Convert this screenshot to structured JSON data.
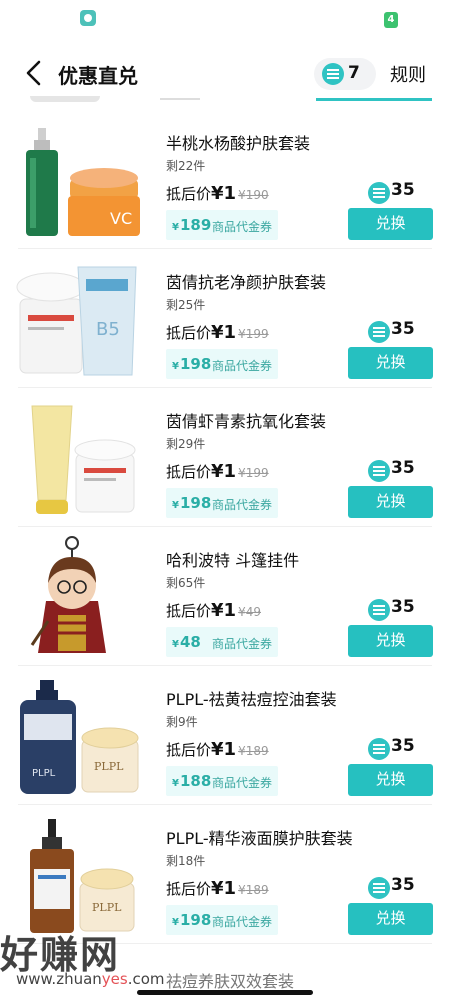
{
  "status_bar": {
    "right_badge": "4"
  },
  "header": {
    "title": "优惠直兑",
    "points": "7",
    "rules": "规则"
  },
  "common": {
    "after_label": "抵后价",
    "yen": "¥",
    "voucher_label": "商品代金券",
    "redeem_label": "兑换"
  },
  "items": [
    {
      "name": "半桃水杨酸护肤套装",
      "stock": "剩22件",
      "after_price": "1",
      "orig_price": "190",
      "voucher": "189",
      "coins": "35"
    },
    {
      "name": "茵倩抗老净颜护肤套装",
      "stock": "剩25件",
      "after_price": "1",
      "orig_price": "199",
      "voucher": "198",
      "coins": "35"
    },
    {
      "name": "茵倩虾青素抗氧化套装",
      "stock": "剩29件",
      "after_price": "1",
      "orig_price": "199",
      "voucher": "198",
      "coins": "35"
    },
    {
      "name": "哈利波特 斗篷挂件",
      "stock": "剩65件",
      "after_price": "1",
      "orig_price": "49",
      "voucher": "48",
      "coins": "35"
    },
    {
      "name": "PLPL-祛黄祛痘控油套装",
      "stock": "剩9件",
      "after_price": "1",
      "orig_price": "189",
      "voucher": "188",
      "coins": "35"
    },
    {
      "name": "PLPL-精华液面膜护肤套装",
      "stock": "剩18件",
      "after_price": "1",
      "orig_price": "189",
      "voucher": "198",
      "coins": "35"
    }
  ],
  "partial_next": "祛痘养肤双效套装",
  "watermark": {
    "cn": "好赚网",
    "url_a": "www.zhuan",
    "url_b": "yes",
    "url_c": ".com"
  },
  "colors": {
    "accent": "#26c0c0",
    "voucher_bg": "#e9fafa"
  }
}
